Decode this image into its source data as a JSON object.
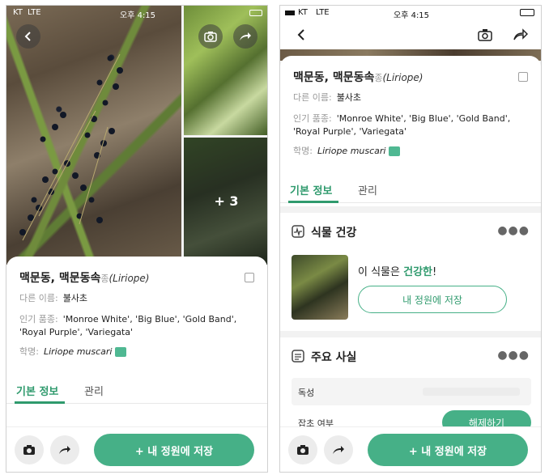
{
  "status_left": {
    "carrier": "KT",
    "network": "LTE",
    "time": "오후 4:15"
  },
  "status_right": {
    "carrier": "KT",
    "network": "LTE",
    "time": "오후 4:15"
  },
  "gallery": {
    "more_count": "+ 3"
  },
  "plant": {
    "common_names": "맥문동, 맥문동속",
    "genus_prefix": "종",
    "genus_latin": "(Liriope)",
    "other_name_label": "다른 이름:",
    "other_name": "불사초",
    "cultivars_label": "인기 품종:",
    "cultivars": "'Monroe White', 'Big Blue', 'Gold Band', 'Royal Purple', 'Variegata'",
    "scientific_label": "학명:",
    "scientific_name": "Liriope muscari"
  },
  "tabs": {
    "basic": "기본 정보",
    "manage": "관리"
  },
  "health": {
    "title": "식물 건강",
    "status_prefix": "이 식물은 ",
    "status_value": "건강한",
    "status_suffix": "!",
    "save_label": "내 정원에 저장"
  },
  "facts": {
    "title": "주요 사실",
    "toxicity_label": "독성",
    "weed_label": "잡초 여부",
    "weed_button": "해제하기"
  },
  "bottom": {
    "save_label": "+ 내 정원에 저장"
  },
  "icons": {
    "back": "chevron-left-icon",
    "camera": "camera-icon",
    "share": "share-icon",
    "edit": "edit-icon",
    "speaker": "speaker-icon",
    "health": "pulse-icon",
    "facts": "list-icon",
    "more": "more-icon"
  },
  "colors": {
    "accent": "#46b087",
    "accent_text": "#2f9a6d"
  }
}
